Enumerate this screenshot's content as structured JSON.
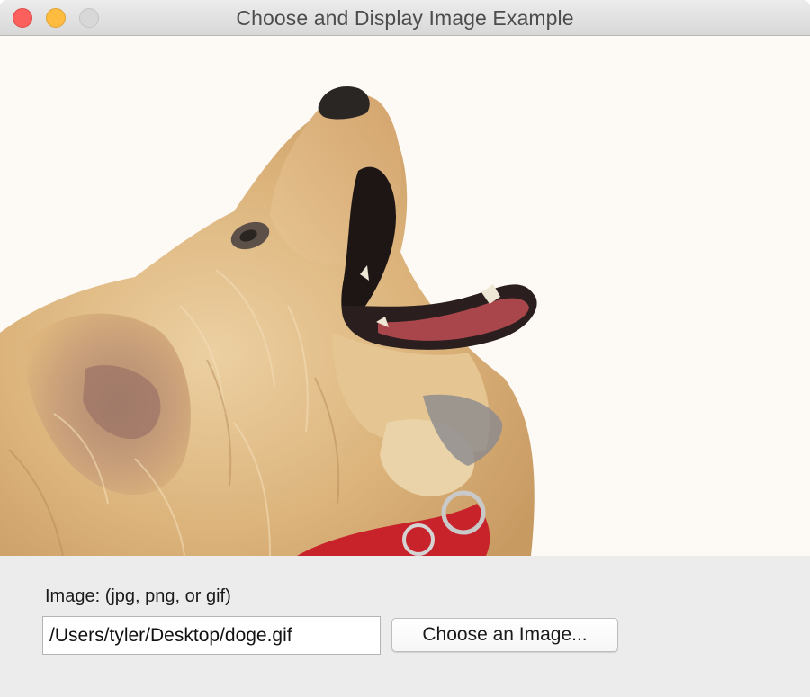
{
  "window": {
    "title": "Choose and Display Image Example"
  },
  "image_view": {
    "subject": "golden retriever dog with open mouth, red collar",
    "background_color": "#fdf9f5"
  },
  "form": {
    "label": "Image: (jpg, png, or gif)",
    "path_value": "/Users/tyler/Desktop/doge.gif",
    "choose_button_label": "Choose an Image..."
  },
  "colors": {
    "close": "#fc605c",
    "minimize": "#fdbc40",
    "zoom_disabled": "#d8d8d8",
    "collar": "#c8232b",
    "fur": "#dcb47c"
  }
}
